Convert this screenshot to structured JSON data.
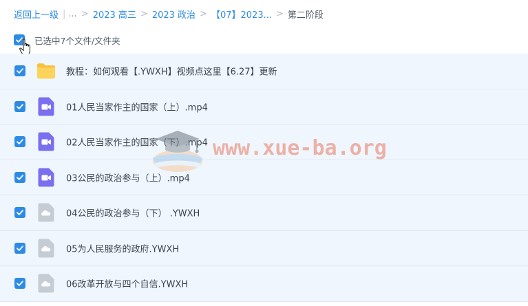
{
  "breadcrumb": {
    "back_label": "返回上一级",
    "ellipsis": "...",
    "items": [
      "2023 高三",
      "2023 政治",
      "【07】2023..."
    ],
    "current": "第二阶段"
  },
  "selection": {
    "summary": "已选中7个文件/文件夹",
    "all_checked": true
  },
  "files": [
    {
      "name": "教程：如何观看【.YWXH】视频点这里【6.27】更新",
      "icon": "folder-icon",
      "checked": true
    },
    {
      "name": "01人民当家作主的国家（上）.mp4",
      "icon": "video-file-icon",
      "checked": true
    },
    {
      "name": "02人民当家作主的国家（下）.mp4",
      "icon": "video-file-icon",
      "checked": true
    },
    {
      "name": "03公民的政治参与（上）.mp4",
      "icon": "video-file-icon",
      "checked": true
    },
    {
      "name": "04公民的政治参与（下） .YWXH",
      "icon": "cloud-file-icon",
      "checked": true
    },
    {
      "name": "05为人民服务的政府.YWXH",
      "icon": "cloud-file-icon",
      "checked": true
    },
    {
      "name": "06改革开放与四个自信.YWXH",
      "icon": "cloud-file-icon",
      "checked": true
    }
  ],
  "watermark": {
    "text": "www.xue-ba.org"
  },
  "colors": {
    "accent": "#2d8be6",
    "row_background": "#f0f6fd",
    "folder": "#fbc94a",
    "video": "#7b6ff0",
    "cloud_file": "#c6ccd4"
  }
}
